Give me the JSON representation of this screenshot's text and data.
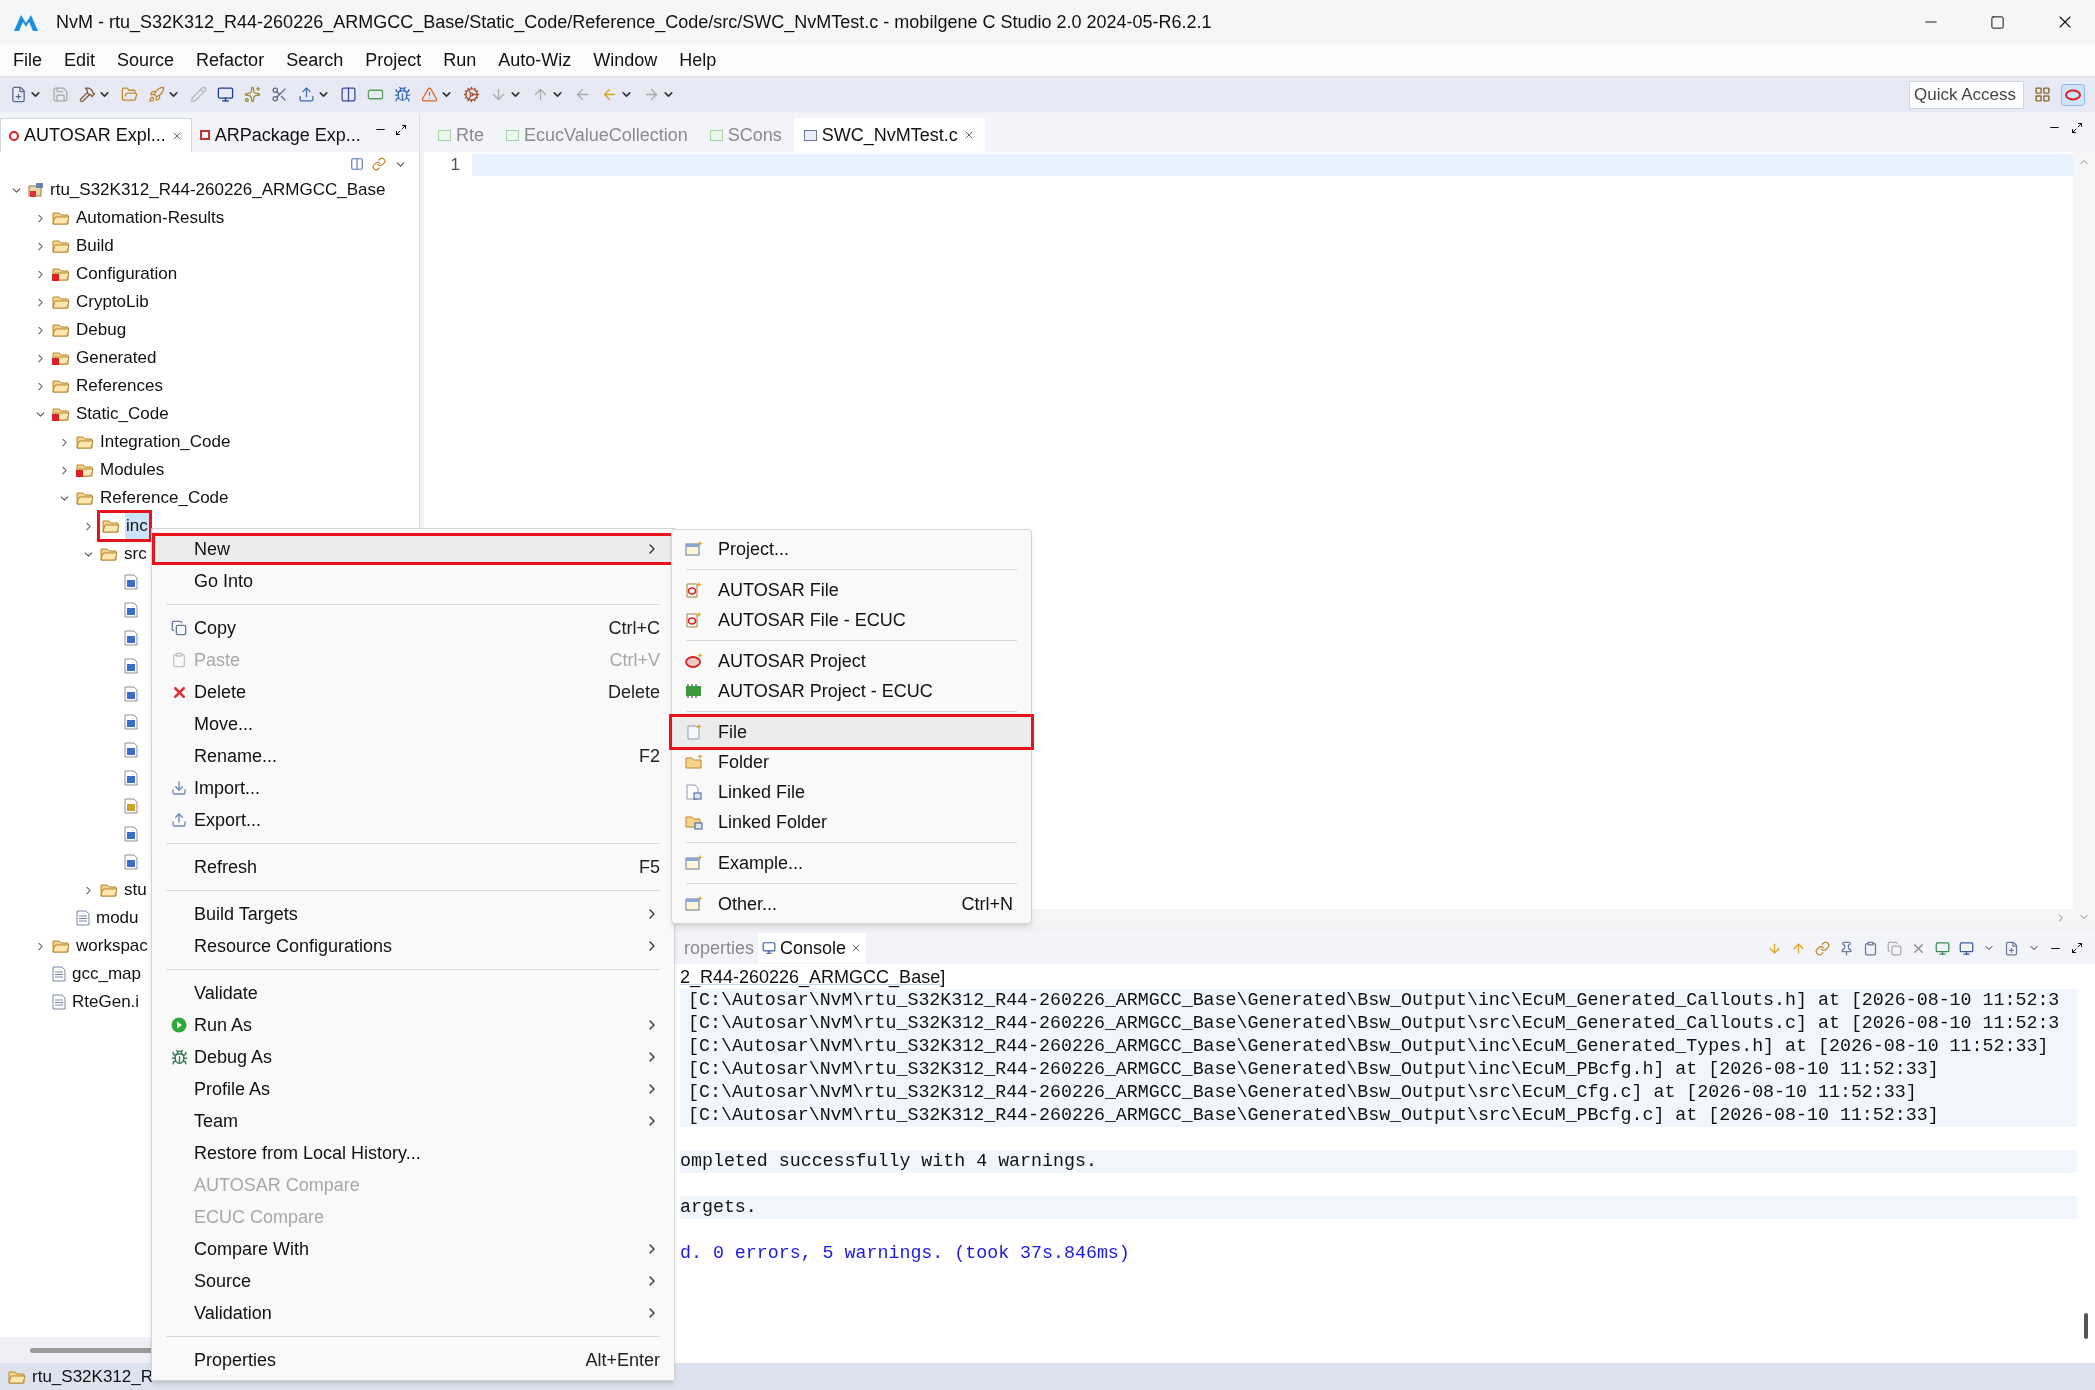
{
  "window": {
    "title": "NvM - rtu_S32K312_R44-260226_ARMGCC_Base/Static_Code/Reference_Code/src/SWC_NvMTest.c - mobilgene C Studio 2.0 2024-05-R6.2.1"
  },
  "menu_bar": [
    "File",
    "Edit",
    "Source",
    "Refactor",
    "Search",
    "Project",
    "Run",
    "Auto-Wiz",
    "Window",
    "Help"
  ],
  "quick_access": {
    "placeholder": "Quick Access"
  },
  "explorer": {
    "tabs": [
      {
        "label": "AUTOSAR Expl...",
        "selected": true
      },
      {
        "label": "ARPackage Exp...",
        "selected": false
      }
    ],
    "tree": [
      {
        "label": "rtu_S32K312_R44-260226_ARMGCC_Base",
        "kind": "project",
        "expanded": true,
        "selected": false,
        "children": [
          {
            "label": "Automation-Results",
            "kind": "folder",
            "expanded": false,
            "selected": false
          },
          {
            "label": "Build",
            "kind": "folder",
            "expanded": false,
            "selected": false
          },
          {
            "label": "Configuration",
            "kind": "error_folder",
            "expanded": false,
            "selected": false
          },
          {
            "label": "CryptoLib",
            "kind": "folder",
            "expanded": false,
            "selected": false
          },
          {
            "label": "Debug",
            "kind": "folder",
            "expanded": false,
            "selected": false
          },
          {
            "label": "Generated",
            "kind": "error_folder",
            "expanded": false,
            "selected": false
          },
          {
            "label": "References",
            "kind": "folder",
            "expanded": false,
            "selected": false
          },
          {
            "label": "Static_Code",
            "kind": "error_folder",
            "expanded": true,
            "selected": false,
            "children": [
              {
                "label": "Integration_Code",
                "kind": "folder",
                "expanded": false,
                "selected": false
              },
              {
                "label": "Modules",
                "kind": "error_folder",
                "expanded": false,
                "selected": false
              },
              {
                "label": "Reference_Code",
                "kind": "folder",
                "expanded": true,
                "selected": false,
                "children": [
                  {
                    "label": "inc",
                    "kind": "folder",
                    "expanded": false,
                    "selected": true
                  },
                  {
                    "label": "src",
                    "kind": "folder",
                    "expanded": true,
                    "selected": false,
                    "children": [
                      {
                        "kind": "c_file",
                        "selected": false
                      },
                      {
                        "kind": "c_file",
                        "selected": false
                      },
                      {
                        "kind": "c_file",
                        "selected": false
                      },
                      {
                        "kind": "c_file",
                        "selected": false
                      },
                      {
                        "kind": "c_file",
                        "selected": false
                      },
                      {
                        "kind": "c_file",
                        "selected": false
                      },
                      {
                        "kind": "c_file",
                        "selected": false
                      },
                      {
                        "kind": "c_file",
                        "selected": false
                      },
                      {
                        "kind": "s_file",
                        "selected": false
                      },
                      {
                        "kind": "c_file",
                        "selected": false
                      },
                      {
                        "kind": "c_file",
                        "selected": false
                      }
                    ]
                  },
                  {
                    "label": "stu",
                    "kind": "folder",
                    "expanded": false,
                    "selected": false
                  }
                ]
              },
              {
                "label": "modu",
                "kind": "text_file",
                "selected": false
              }
            ]
          },
          {
            "label": "workspac",
            "kind": "folder",
            "expanded": false,
            "selected": false
          },
          {
            "label": "gcc_map",
            "kind": "text_file",
            "selected": false
          },
          {
            "label": "RteGen.i",
            "kind": "text_file",
            "selected": false
          }
        ]
      }
    ]
  },
  "editor": {
    "tabs": [
      {
        "label": "Rte",
        "selected": false
      },
      {
        "label": "EcucValueCollection",
        "selected": false
      },
      {
        "label": "SCons",
        "selected": false
      },
      {
        "label": "SWC_NvMTest.c",
        "selected": true
      }
    ],
    "line_numbers": [
      "1"
    ]
  },
  "console": {
    "tabs": [
      {
        "label": "roperties",
        "selected": false
      },
      {
        "label": "Console",
        "selected": true
      }
    ],
    "lines": [
      {
        "kind": "header",
        "text": "2_R44-260226_ARMGCC_Base]"
      },
      {
        "kind": "path",
        "text": "[C:\\Autosar\\NvM\\rtu_S32K312_R44-260226_ARMGCC_Base\\Generated\\Bsw_Output\\inc\\EcuM_Generated_Callouts.h] at [2026-08-10 11:52:3"
      },
      {
        "kind": "path",
        "text": "[C:\\Autosar\\NvM\\rtu_S32K312_R44-260226_ARMGCC_Base\\Generated\\Bsw_Output\\src\\EcuM_Generated_Callouts.c] at [2026-08-10 11:52:3"
      },
      {
        "kind": "path",
        "text": "[C:\\Autosar\\NvM\\rtu_S32K312_R44-260226_ARMGCC_Base\\Generated\\Bsw_Output\\inc\\EcuM_Generated_Types.h] at [2026-08-10 11:52:33]"
      },
      {
        "kind": "path",
        "text": "[C:\\Autosar\\NvM\\rtu_S32K312_R44-260226_ARMGCC_Base\\Generated\\Bsw_Output\\inc\\EcuM_PBcfg.h] at [2026-08-10 11:52:33]"
      },
      {
        "kind": "path",
        "text": "[C:\\Autosar\\NvM\\rtu_S32K312_R44-260226_ARMGCC_Base\\Generated\\Bsw_Output\\src\\EcuM_Cfg.c] at [2026-08-10 11:52:33]"
      },
      {
        "kind": "path",
        "text": "[C:\\Autosar\\NvM\\rtu_S32K312_R44-260226_ARMGCC_Base\\Generated\\Bsw_Output\\src\\EcuM_PBcfg.c] at [2026-08-10 11:52:33]"
      },
      {
        "kind": "status",
        "text": "ompleted successfully with 4 warnings."
      },
      {
        "kind": "status",
        "text": "argets."
      },
      {
        "kind": "result",
        "text": "d. 0 errors, 5 warnings. (took 37s.846ms)"
      }
    ]
  },
  "context_menu": {
    "groups": [
      [
        {
          "label": "New",
          "submenu": true,
          "disabled": false,
          "selected": true
        },
        {
          "label": "Go Into",
          "submenu": false,
          "disabled": false,
          "selected": false
        }
      ],
      [
        {
          "label": "Copy",
          "shortcut": "Ctrl+C",
          "submenu": false,
          "disabled": false,
          "selected": false
        },
        {
          "label": "Paste",
          "shortcut": "Ctrl+V",
          "submenu": false,
          "disabled": true,
          "selected": false
        },
        {
          "label": "Delete",
          "shortcut": "Delete",
          "submenu": false,
          "disabled": false,
          "selected": false
        },
        {
          "label": "Move...",
          "submenu": false,
          "disabled": false,
          "selected": false
        },
        {
          "label": "Rename...",
          "shortcut": "F2",
          "submenu": false,
          "disabled": false,
          "selected": false
        },
        {
          "label": "Import...",
          "submenu": false,
          "disabled": false,
          "selected": false
        },
        {
          "label": "Export...",
          "submenu": false,
          "disabled": false,
          "selected": false
        }
      ],
      [
        {
          "label": "Refresh",
          "shortcut": "F5",
          "submenu": false,
          "disabled": false,
          "selected": false
        }
      ],
      [
        {
          "label": "Build Targets",
          "submenu": true,
          "disabled": false,
          "selected": false
        },
        {
          "label": "Resource Configurations",
          "submenu": true,
          "disabled": false,
          "selected": false
        }
      ],
      [
        {
          "label": "Validate",
          "submenu": false,
          "disabled": false,
          "selected": false
        },
        {
          "label": "Run As",
          "submenu": true,
          "disabled": false,
          "selected": false
        },
        {
          "label": "Debug As",
          "submenu": true,
          "disabled": false,
          "selected": false
        },
        {
          "label": "Profile As",
          "submenu": true,
          "disabled": false,
          "selected": false
        },
        {
          "label": "Team",
          "submenu": true,
          "disabled": false,
          "selected": false
        },
        {
          "label": "Restore from Local History...",
          "submenu": false,
          "disabled": false,
          "selected": false
        },
        {
          "label": "AUTOSAR Compare",
          "submenu": false,
          "disabled": true,
          "selected": false
        },
        {
          "label": "ECUC Compare",
          "submenu": false,
          "disabled": true,
          "selected": false
        },
        {
          "label": "Compare With",
          "submenu": true,
          "disabled": false,
          "selected": false
        },
        {
          "label": "Source",
          "submenu": true,
          "disabled": false,
          "selected": false
        },
        {
          "label": "Validation",
          "submenu": true,
          "disabled": false,
          "selected": false
        }
      ],
      [
        {
          "label": "Properties",
          "shortcut": "Alt+Enter",
          "submenu": false,
          "disabled": false,
          "selected": false
        }
      ]
    ]
  },
  "new_submenu": {
    "groups": [
      [
        {
          "label": "Project...",
          "kind": "wizard",
          "selected": false
        }
      ],
      [
        {
          "label": "AUTOSAR File",
          "kind": "autosar_file",
          "selected": false
        },
        {
          "label": "AUTOSAR File - ECUC",
          "kind": "autosar_file",
          "selected": false
        }
      ],
      [
        {
          "label": "AUTOSAR Project",
          "kind": "autosar_project",
          "selected": false
        },
        {
          "label": "AUTOSAR Project - ECUC",
          "kind": "ecu_project",
          "selected": false
        }
      ],
      [
        {
          "label": "File",
          "kind": "file",
          "selected": true
        },
        {
          "label": "Folder",
          "kind": "folder",
          "selected": false
        },
        {
          "label": "Linked File",
          "kind": "linked_file",
          "selected": false
        },
        {
          "label": "Linked Folder",
          "kind": "linked_folder",
          "selected": false
        }
      ],
      [
        {
          "label": "Example...",
          "kind": "wizard",
          "selected": false
        }
      ],
      [
        {
          "label": "Other...",
          "shortcut": "Ctrl+N",
          "kind": "wizard",
          "selected": false
        }
      ]
    ]
  },
  "status_bar": {
    "text": "rtu_S32K312_R"
  }
}
